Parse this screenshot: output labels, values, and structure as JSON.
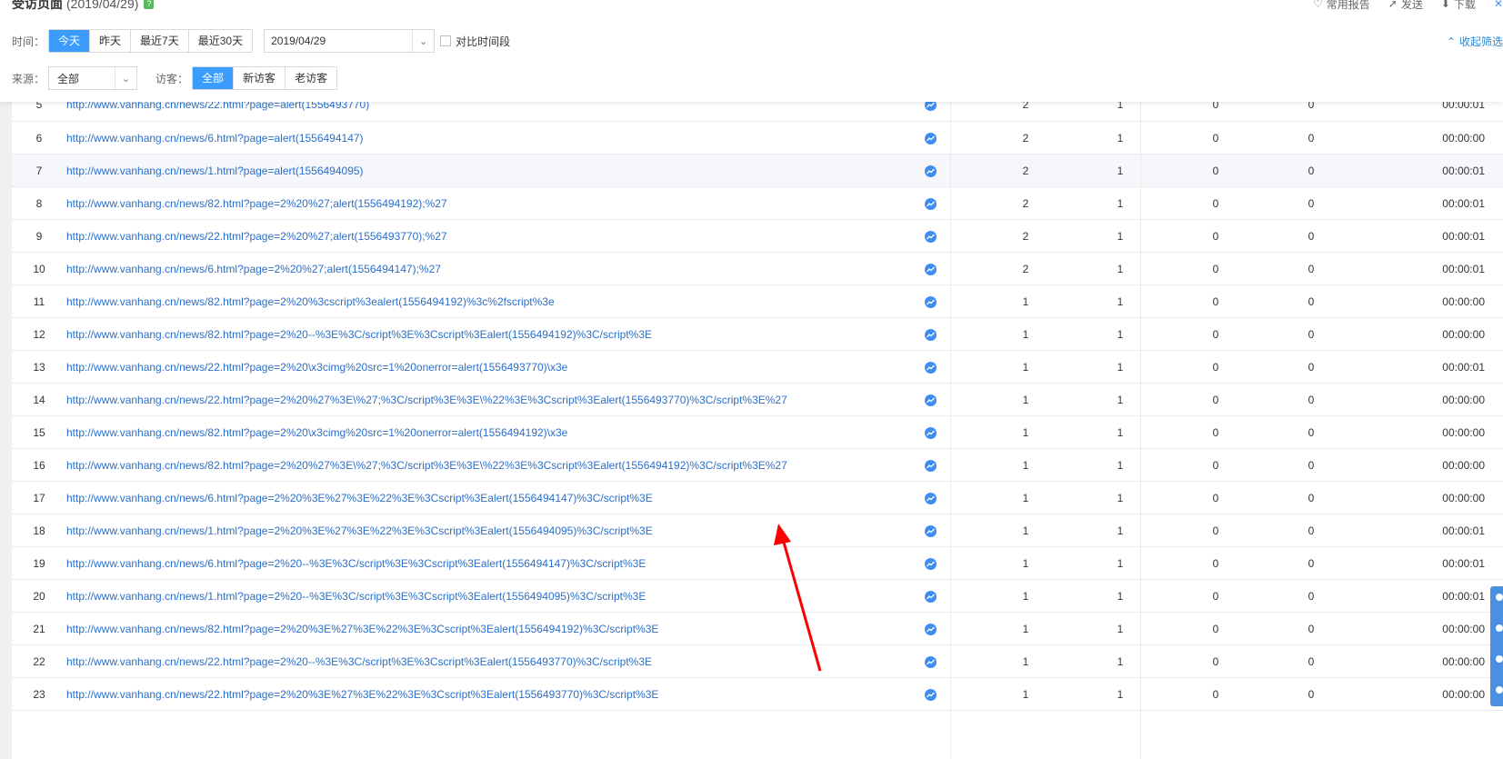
{
  "header": {
    "title": "受访页面",
    "date": "(2019/04/29)",
    "help_icon": "?",
    "actions": [
      {
        "label": "常用报告",
        "icon": "heart-icon"
      },
      {
        "label": "发送",
        "icon": "send-icon"
      },
      {
        "label": "下载",
        "icon": "download-icon"
      }
    ]
  },
  "filters": {
    "time_label": "时间：",
    "time_options": [
      "今天",
      "昨天",
      "最近7天",
      "最近30天"
    ],
    "time_active": "今天",
    "date_value": "2019/04/29",
    "compare_label": "对比时间段",
    "collapse_label": "收起筛选",
    "source_label": "来源：",
    "source_value": "全部",
    "visitor_label": "访客：",
    "visitor_options": [
      "全部",
      "新访客",
      "老访客"
    ],
    "visitor_active": "全部"
  },
  "rows": [
    {
      "idx": "5",
      "url": "http://www.vanhang.cn/news/22.html?page=alert(1556493770)",
      "n1": "2",
      "n2": "1",
      "n3": "0",
      "n4": "0",
      "time": "00:00:01"
    },
    {
      "idx": "6",
      "url": "http://www.vanhang.cn/news/6.html?page=alert(1556494147)",
      "n1": "2",
      "n2": "1",
      "n3": "0",
      "n4": "0",
      "time": "00:00:00"
    },
    {
      "idx": "7",
      "url": "http://www.vanhang.cn/news/1.html?page=alert(1556494095)",
      "n1": "2",
      "n2": "1",
      "n3": "0",
      "n4": "0",
      "time": "00:00:01"
    },
    {
      "idx": "8",
      "url": "http://www.vanhang.cn/news/82.html?page=2%20%27;alert(1556494192);%27",
      "n1": "2",
      "n2": "1",
      "n3": "0",
      "n4": "0",
      "time": "00:00:01"
    },
    {
      "idx": "9",
      "url": "http://www.vanhang.cn/news/22.html?page=2%20%27;alert(1556493770);%27",
      "n1": "2",
      "n2": "1",
      "n3": "0",
      "n4": "0",
      "time": "00:00:01"
    },
    {
      "idx": "10",
      "url": "http://www.vanhang.cn/news/6.html?page=2%20%27;alert(1556494147);%27",
      "n1": "2",
      "n2": "1",
      "n3": "0",
      "n4": "0",
      "time": "00:00:01"
    },
    {
      "idx": "11",
      "url": "http://www.vanhang.cn/news/82.html?page=2%20%3cscript%3ealert(1556494192)%3c%2fscript%3e",
      "n1": "1",
      "n2": "1",
      "n3": "0",
      "n4": "0",
      "time": "00:00:00"
    },
    {
      "idx": "12",
      "url": "http://www.vanhang.cn/news/82.html?page=2%20--%3E%3C/script%3E%3Cscript%3Ealert(1556494192)%3C/script%3E",
      "n1": "1",
      "n2": "1",
      "n3": "0",
      "n4": "0",
      "time": "00:00:00"
    },
    {
      "idx": "13",
      "url": "http://www.vanhang.cn/news/22.html?page=2%20\\x3cimg%20src=1%20onerror=alert(1556493770)\\x3e",
      "n1": "1",
      "n2": "1",
      "n3": "0",
      "n4": "0",
      "time": "00:00:01"
    },
    {
      "idx": "14",
      "url": "http://www.vanhang.cn/news/22.html?page=2%20%27%3E\\%27;%3C/script%3E%3E\\%22%3E%3Cscript%3Ealert(1556493770)%3C/script%3E%27",
      "n1": "1",
      "n2": "1",
      "n3": "0",
      "n4": "0",
      "time": "00:00:00"
    },
    {
      "idx": "15",
      "url": "http://www.vanhang.cn/news/82.html?page=2%20\\x3cimg%20src=1%20onerror=alert(1556494192)\\x3e",
      "n1": "1",
      "n2": "1",
      "n3": "0",
      "n4": "0",
      "time": "00:00:00"
    },
    {
      "idx": "16",
      "url": "http://www.vanhang.cn/news/82.html?page=2%20%27%3E\\%27;%3C/script%3E%3E\\%22%3E%3Cscript%3Ealert(1556494192)%3C/script%3E%27",
      "n1": "1",
      "n2": "1",
      "n3": "0",
      "n4": "0",
      "time": "00:00:00"
    },
    {
      "idx": "17",
      "url": "http://www.vanhang.cn/news/6.html?page=2%20%3E%27%3E%22%3E%3Cscript%3Ealert(1556494147)%3C/script%3E",
      "n1": "1",
      "n2": "1",
      "n3": "0",
      "n4": "0",
      "time": "00:00:00"
    },
    {
      "idx": "18",
      "url": "http://www.vanhang.cn/news/1.html?page=2%20%3E%27%3E%22%3E%3Cscript%3Ealert(1556494095)%3C/script%3E",
      "n1": "1",
      "n2": "1",
      "n3": "0",
      "n4": "0",
      "time": "00:00:01"
    },
    {
      "idx": "19",
      "url": "http://www.vanhang.cn/news/6.html?page=2%20--%3E%3C/script%3E%3Cscript%3Ealert(1556494147)%3C/script%3E",
      "n1": "1",
      "n2": "1",
      "n3": "0",
      "n4": "0",
      "time": "00:00:01"
    },
    {
      "idx": "20",
      "url": "http://www.vanhang.cn/news/1.html?page=2%20--%3E%3C/script%3E%3Cscript%3Ealert(1556494095)%3C/script%3E",
      "n1": "1",
      "n2": "1",
      "n3": "0",
      "n4": "0",
      "time": "00:00:01"
    },
    {
      "idx": "21",
      "url": "http://www.vanhang.cn/news/82.html?page=2%20%3E%27%3E%22%3E%3Cscript%3Ealert(1556494192)%3C/script%3E",
      "n1": "1",
      "n2": "1",
      "n3": "0",
      "n4": "0",
      "time": "00:00:00"
    },
    {
      "idx": "22",
      "url": "http://www.vanhang.cn/news/22.html?page=2%20--%3E%3C/script%3E%3Cscript%3Ealert(1556493770)%3C/script%3E",
      "n1": "1",
      "n2": "1",
      "n3": "0",
      "n4": "0",
      "time": "00:00:00"
    },
    {
      "idx": "23",
      "url": "http://www.vanhang.cn/news/22.html?page=2%20%3E%27%3E%22%3E%3Cscript%3Ealert(1556493770)%3C/script%3E",
      "n1": "1",
      "n2": "1",
      "n3": "0",
      "n4": "0",
      "time": "00:00:00"
    }
  ],
  "hover_row": "7",
  "colors": {
    "accent": "#3c9cfd",
    "link": "#2b6fc9",
    "trend_icon": "#3d8ef0",
    "annotation_arrow": "#ff0000"
  }
}
